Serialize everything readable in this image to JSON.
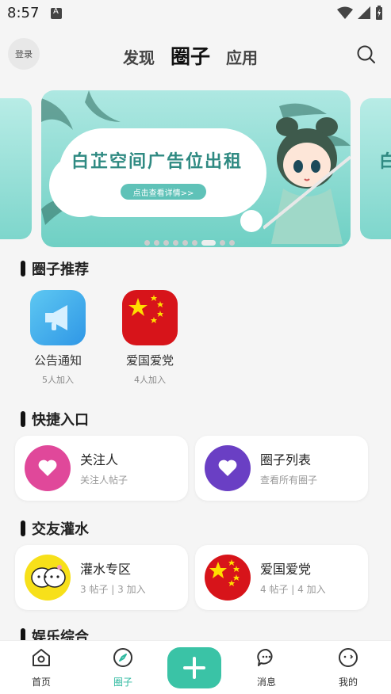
{
  "status": {
    "time": "8:57"
  },
  "header": {
    "login_label": "登录",
    "tabs": [
      {
        "label": "发现"
      },
      {
        "label": "圈子"
      },
      {
        "label": "应用"
      }
    ]
  },
  "banner": {
    "title": "白芷空间广告位出租",
    "button_label": "点击查看详情>>",
    "side_title": "白",
    "dots_count": 9,
    "active_dot": 6
  },
  "recommend": {
    "title": "圈子推荐",
    "items": [
      {
        "name": "公告通知",
        "count": "5人加入",
        "icon": "megaphone-icon"
      },
      {
        "name": "爱国爱党",
        "count": "4人加入",
        "icon": "china-flag-icon"
      }
    ]
  },
  "shortcuts": {
    "title": "快捷入口",
    "items": [
      {
        "title": "关注人",
        "sub": "关注人帖子",
        "color": "#e0489a",
        "icon": "heart-icon"
      },
      {
        "title": "圈子列表",
        "sub": "查看所有圈子",
        "color": "#6a3fc4",
        "icon": "heart-icon"
      }
    ]
  },
  "social": {
    "title": "交友灌水",
    "items": [
      {
        "title": "灌水专区",
        "sub": "3 帖子 | 3 加入",
        "icon": "chat-faces-icon"
      },
      {
        "title": "爱国爱党",
        "sub": "4 帖子 | 4 加入",
        "icon": "china-flag-icon"
      }
    ]
  },
  "entertainment": {
    "title": "娱乐综合"
  },
  "bottom_nav": [
    {
      "label": "首页",
      "icon": "home-icon"
    },
    {
      "label": "圈子",
      "icon": "compass-icon",
      "active": true
    },
    {
      "label": "",
      "icon": "plus-icon"
    },
    {
      "label": "消息",
      "icon": "message-icon"
    },
    {
      "label": "我的",
      "icon": "profile-icon"
    }
  ],
  "colors": {
    "accent": "#3ac3a6",
    "active_tab": "#2fb9a0"
  }
}
